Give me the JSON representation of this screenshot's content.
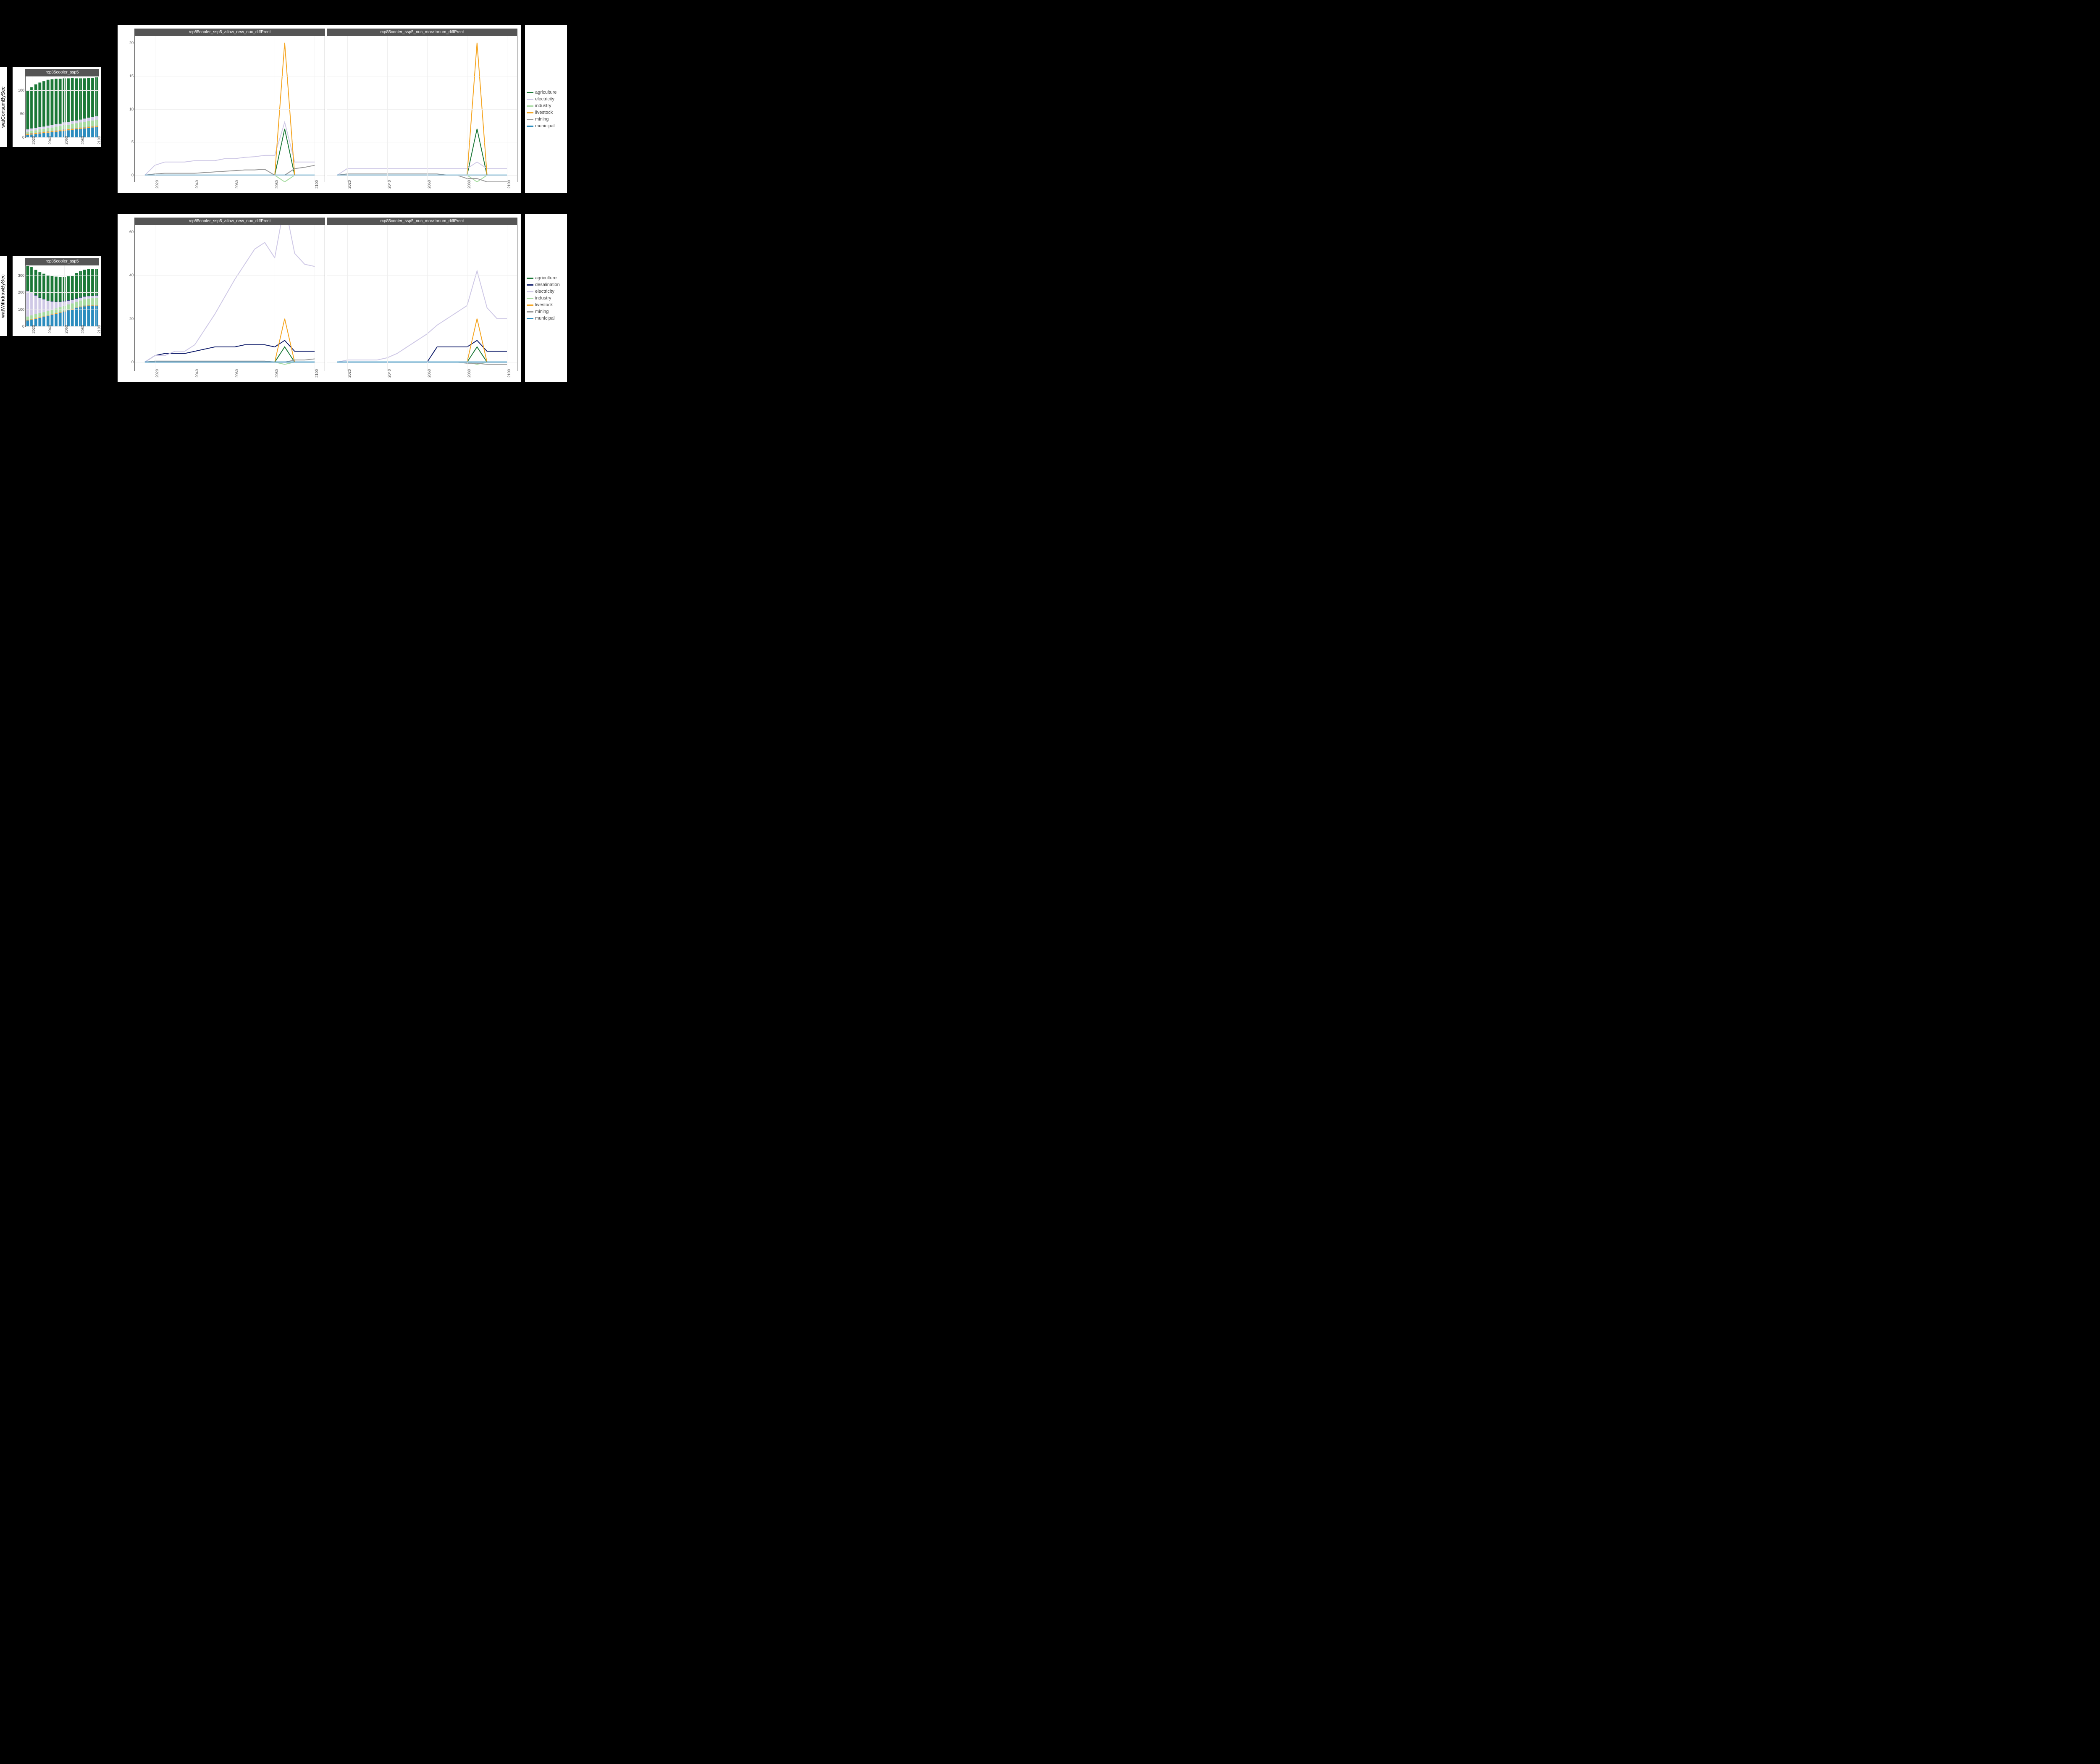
{
  "rows": [
    {
      "ylabel": "watConsumBySec",
      "small": {
        "title": "rcp85cooler_ssp5",
        "yticks": [
          0,
          50,
          100
        ]
      },
      "big_yticks": [
        0,
        5,
        10,
        15,
        20
      ],
      "panels": [
        "rcp85cooler_ssp5_allow_new_nuc_diffPrcnt",
        "rcp85cooler_ssp5_nuc_moratorium_diffPrcnt"
      ],
      "legend": [
        "agriculture",
        "electricity",
        "industry",
        "livestock",
        "mining",
        "municipal"
      ]
    },
    {
      "ylabel": "watWithdrawBySec",
      "small": {
        "title": "rcp85cooler_ssp5",
        "yticks": [
          0,
          100,
          200,
          300
        ]
      },
      "big_yticks": [
        0,
        20,
        40,
        60
      ],
      "panels": [
        "rcp85cooler_ssp5_allow_new_nuc_diffPrcnt",
        "rcp85cooler_ssp5_nuc_moratorium_diffPrcnt"
      ],
      "legend": [
        "agriculture",
        "desalination",
        "electricity",
        "industry",
        "livestock",
        "mining",
        "municipal"
      ]
    }
  ],
  "xticks": [
    2020,
    2040,
    2060,
    2080,
    2100
  ],
  "colors": {
    "agriculture": "#1b7837",
    "desalination": "#101d6b",
    "electricity": "#cfc9e6",
    "industry": "#a6dba0",
    "livestock": "#f5a623",
    "mining": "#999999",
    "municipal": "#2b8cbe"
  },
  "chart_data": [
    {
      "name": "watConsumBySec_stacked_bar",
      "type": "bar",
      "title": "rcp85cooler_ssp5",
      "xlabel": "",
      "ylabel": "watConsumBySec",
      "ylim": [
        0,
        130
      ],
      "x": [
        2015,
        2020,
        2025,
        2030,
        2035,
        2040,
        2045,
        2050,
        2055,
        2060,
        2065,
        2070,
        2075,
        2080,
        2085,
        2090,
        2095,
        2100
      ],
      "stack_order": [
        "municipal",
        "livestock",
        "mining",
        "industry",
        "electricity",
        "agriculture"
      ],
      "series": [
        {
          "name": "municipal",
          "values": [
            5,
            6,
            7,
            8,
            9,
            10,
            11,
            12,
            13,
            14,
            15,
            16,
            17,
            18,
            19,
            20,
            21,
            22
          ]
        },
        {
          "name": "livestock",
          "values": [
            2,
            2,
            2,
            2,
            2,
            2,
            2,
            2,
            2,
            2,
            2,
            2,
            2,
            2,
            2,
            2,
            2,
            2
          ]
        },
        {
          "name": "mining",
          "values": [
            1,
            1,
            1,
            1,
            1,
            1,
            1,
            1,
            1,
            1,
            1,
            1,
            1,
            1,
            1,
            1,
            1,
            1
          ]
        },
        {
          "name": "industry",
          "values": [
            4,
            5,
            5,
            6,
            6,
            7,
            7,
            8,
            8,
            9,
            9,
            10,
            10,
            11,
            11,
            12,
            12,
            13
          ]
        },
        {
          "name": "electricity",
          "values": [
            5,
            5,
            5,
            5,
            5,
            5,
            5,
            5,
            5,
            6,
            6,
            6,
            6,
            6,
            7,
            7,
            7,
            7
          ]
        },
        {
          "name": "agriculture",
          "values": [
            83,
            88,
            93,
            95,
            97,
            98,
            98,
            97,
            96,
            94,
            93,
            92,
            90,
            88,
            86,
            85,
            84,
            83
          ]
        }
      ]
    },
    {
      "name": "watConsumBySec_diff_allow_new_nuc",
      "type": "line",
      "title": "rcp85cooler_ssp5_allow_new_nuc_diffPrcnt",
      "xlabel": "",
      "ylabel": "",
      "ylim": [
        -2,
        21
      ],
      "xlim": [
        2010,
        2105
      ],
      "x": [
        2015,
        2020,
        2025,
        2030,
        2035,
        2040,
        2045,
        2050,
        2055,
        2060,
        2065,
        2070,
        2075,
        2080,
        2085,
        2090,
        2095,
        2100
      ],
      "series": [
        {
          "name": "agriculture",
          "values": [
            0,
            0,
            0,
            0,
            0,
            0,
            0,
            0,
            0,
            0,
            0,
            0,
            0,
            0,
            7,
            0,
            0,
            0
          ]
        },
        {
          "name": "electricity",
          "values": [
            0,
            1.5,
            2,
            2,
            2,
            2.2,
            2.2,
            2.2,
            2.5,
            2.5,
            2.7,
            2.8,
            3,
            3,
            8,
            2,
            2,
            2
          ]
        },
        {
          "name": "industry",
          "values": [
            0,
            0,
            0,
            0,
            0,
            0,
            0,
            0,
            0,
            0,
            0,
            0,
            0,
            0,
            -1,
            0,
            0,
            0
          ]
        },
        {
          "name": "livestock",
          "values": [
            0,
            0,
            0,
            0,
            0,
            0,
            0,
            0,
            0,
            0,
            0,
            0,
            0,
            0,
            20,
            0,
            0,
            0
          ]
        },
        {
          "name": "mining",
          "values": [
            0,
            0.2,
            0.3,
            0.3,
            0.3,
            0.3,
            0.4,
            0.5,
            0.6,
            0.7,
            0.8,
            0.8,
            0.9,
            0,
            0,
            1,
            1.2,
            1.5
          ]
        },
        {
          "name": "municipal",
          "values": [
            0,
            0,
            0,
            0,
            0,
            0,
            0,
            0,
            0,
            0,
            0,
            0,
            0,
            0,
            0,
            0,
            0,
            0
          ]
        }
      ]
    },
    {
      "name": "watConsumBySec_diff_nuc_moratorium",
      "type": "line",
      "title": "rcp85cooler_ssp5_nuc_moratorium_diffPrcnt",
      "xlabel": "",
      "ylabel": "",
      "ylim": [
        -2,
        21
      ],
      "xlim": [
        2010,
        2105
      ],
      "x": [
        2015,
        2020,
        2025,
        2030,
        2035,
        2040,
        2045,
        2050,
        2055,
        2060,
        2065,
        2070,
        2075,
        2080,
        2085,
        2090,
        2095,
        2100
      ],
      "series": [
        {
          "name": "agriculture",
          "values": [
            0,
            0,
            0,
            0,
            0,
            0,
            0,
            0,
            0,
            0,
            0,
            0,
            0,
            0,
            7,
            0,
            0,
            0
          ]
        },
        {
          "name": "electricity",
          "values": [
            0,
            1,
            1,
            1,
            1,
            1,
            1,
            1,
            1,
            1,
            1,
            1,
            1,
            1,
            2,
            1,
            1,
            1
          ]
        },
        {
          "name": "industry",
          "values": [
            0,
            0,
            0,
            0,
            0,
            0,
            0,
            0,
            0,
            0,
            0,
            0,
            0,
            0,
            -1,
            0,
            0,
            0
          ]
        },
        {
          "name": "livestock",
          "values": [
            0,
            0,
            0,
            0,
            0,
            0,
            0,
            0,
            0,
            0,
            0,
            0,
            0,
            0,
            20,
            0,
            0,
            0
          ]
        },
        {
          "name": "mining",
          "values": [
            0,
            0.2,
            0.2,
            0.2,
            0.2,
            0.2,
            0.2,
            0.2,
            0.2,
            0.2,
            0.2,
            0,
            0,
            -0.5,
            -0.5,
            -1,
            -1,
            -1
          ]
        },
        {
          "name": "municipal",
          "values": [
            0,
            0,
            0,
            0,
            0,
            0,
            0,
            0,
            0,
            0,
            0,
            0,
            0,
            0,
            0,
            0,
            0,
            0
          ]
        }
      ]
    },
    {
      "name": "watWithdrawBySec_stacked_bar",
      "type": "bar",
      "title": "rcp85cooler_ssp5",
      "xlabel": "",
      "ylabel": "watWithdrawBySec",
      "ylim": [
        0,
        360
      ],
      "x": [
        2015,
        2020,
        2025,
        2030,
        2035,
        2040,
        2045,
        2050,
        2055,
        2060,
        2065,
        2070,
        2075,
        2080,
        2085,
        2090,
        2095,
        2100
      ],
      "stack_order": [
        "municipal",
        "livestock",
        "mining",
        "industry",
        "electricity",
        "desalination",
        "agriculture"
      ],
      "series": [
        {
          "name": "municipal",
          "values": [
            35,
            40,
            45,
            50,
            55,
            60,
            67,
            74,
            81,
            88,
            95,
            100,
            107,
            113,
            118,
            120,
            120,
            120
          ]
        },
        {
          "name": "livestock",
          "values": [
            3,
            3,
            3,
            3,
            3,
            3,
            3,
            3,
            3,
            3,
            3,
            3,
            3,
            3,
            3,
            3,
            3,
            3
          ]
        },
        {
          "name": "mining",
          "values": [
            2,
            2,
            2,
            2,
            2,
            2,
            2,
            2,
            2,
            2,
            2,
            2,
            2,
            2,
            2,
            2,
            2,
            2
          ]
        },
        {
          "name": "industry",
          "values": [
            18,
            20,
            22,
            23,
            24,
            25,
            26,
            27,
            28,
            29,
            30,
            31,
            33,
            35,
            37,
            39,
            41,
            43
          ]
        },
        {
          "name": "electricity",
          "values": [
            150,
            135,
            110,
            90,
            75,
            60,
            48,
            38,
            30,
            25,
            22,
            20,
            18,
            16,
            15,
            14,
            13,
            13
          ]
        },
        {
          "name": "desalination",
          "values": [
            2,
            2,
            2,
            2,
            2,
            2,
            2,
            2,
            2,
            2,
            2,
            2,
            2,
            2,
            2,
            2,
            2,
            2
          ]
        },
        {
          "name": "agriculture",
          "values": [
            145,
            148,
            150,
            150,
            150,
            150,
            150,
            148,
            146,
            144,
            142,
            140,
            150,
            155,
            158,
            158,
            157,
            157
          ]
        }
      ]
    },
    {
      "name": "watWithdrawBySec_diff_allow_new_nuc",
      "type": "line",
      "title": "rcp85cooler_ssp5_allow_new_nuc_diffPrcnt",
      "xlabel": "",
      "ylabel": "",
      "ylim": [
        -3,
        75
      ],
      "xlim": [
        2010,
        2105
      ],
      "x": [
        2015,
        2020,
        2025,
        2030,
        2035,
        2040,
        2045,
        2050,
        2055,
        2060,
        2065,
        2070,
        2075,
        2080,
        2085,
        2090,
        2095,
        2100
      ],
      "series": [
        {
          "name": "agriculture",
          "values": [
            0,
            0,
            0,
            0,
            0,
            0,
            0,
            0,
            0,
            0,
            0,
            0,
            0,
            0,
            7,
            0,
            0,
            0
          ]
        },
        {
          "name": "desalination",
          "values": [
            0,
            3,
            4,
            4,
            4,
            5,
            6,
            7,
            7,
            7,
            8,
            8,
            8,
            7,
            10,
            5,
            5,
            5
          ]
        },
        {
          "name": "electricity",
          "values": [
            0,
            3,
            3,
            5,
            5,
            8,
            15,
            22,
            30,
            38,
            45,
            52,
            55,
            48,
            73,
            50,
            45,
            44
          ]
        },
        {
          "name": "industry",
          "values": [
            0,
            0,
            0,
            0,
            0,
            0,
            0,
            0,
            0,
            0,
            0,
            0,
            0,
            0,
            -1,
            0,
            0,
            0
          ]
        },
        {
          "name": "livestock",
          "values": [
            0,
            0,
            0,
            0,
            0,
            0,
            0,
            0,
            0,
            0,
            0,
            0,
            0,
            0,
            20,
            0,
            0,
            0
          ]
        },
        {
          "name": "mining",
          "values": [
            0,
            0.5,
            0.5,
            0.5,
            0.5,
            0.5,
            0.5,
            0.5,
            0.5,
            0.5,
            0.5,
            0.5,
            0.5,
            0,
            0,
            1,
            1,
            1.5
          ]
        },
        {
          "name": "municipal",
          "values": [
            0,
            0,
            0,
            0,
            0,
            0,
            0,
            0,
            0,
            0,
            0,
            0,
            0,
            0,
            0,
            0,
            0,
            0
          ]
        }
      ]
    },
    {
      "name": "watWithdrawBySec_diff_nuc_moratorium",
      "type": "line",
      "title": "rcp85cooler_ssp5_nuc_moratorium_diffPrcnt",
      "xlabel": "",
      "ylabel": "",
      "ylim": [
        -3,
        75
      ],
      "xlim": [
        2010,
        2105
      ],
      "x": [
        2015,
        2020,
        2025,
        2030,
        2035,
        2040,
        2045,
        2050,
        2055,
        2060,
        2065,
        2070,
        2075,
        2080,
        2085,
        2090,
        2095,
        2100
      ],
      "series": [
        {
          "name": "agriculture",
          "values": [
            0,
            0,
            0,
            0,
            0,
            0,
            0,
            0,
            0,
            0,
            0,
            0,
            0,
            0,
            7,
            0,
            0,
            0
          ]
        },
        {
          "name": "desalination",
          "values": [
            0,
            0,
            0,
            0,
            0,
            0,
            0,
            0,
            0,
            0,
            7,
            7,
            7,
            7,
            10,
            5,
            5,
            5
          ]
        },
        {
          "name": "electricity",
          "values": [
            0,
            1,
            1,
            1,
            1,
            2,
            4,
            7,
            10,
            13,
            17,
            20,
            23,
            26,
            42,
            25,
            20,
            20
          ]
        },
        {
          "name": "industry",
          "values": [
            0,
            0,
            0,
            0,
            0,
            0,
            0,
            0,
            0,
            0,
            0,
            0,
            0,
            0,
            -1,
            0,
            0,
            0
          ]
        },
        {
          "name": "livestock",
          "values": [
            0,
            0,
            0,
            0,
            0,
            0,
            0,
            0,
            0,
            0,
            0,
            0,
            0,
            0,
            20,
            0,
            0,
            0
          ]
        },
        {
          "name": "mining",
          "values": [
            0,
            0,
            0,
            0,
            0,
            0,
            0,
            0,
            0,
            0,
            0,
            0,
            0,
            -0.5,
            -0.5,
            -1,
            -1,
            -1
          ]
        },
        {
          "name": "municipal",
          "values": [
            0,
            0,
            0,
            0,
            0,
            0,
            0,
            0,
            0,
            0,
            0,
            0,
            0,
            0,
            0,
            0,
            0,
            0
          ]
        }
      ]
    }
  ]
}
